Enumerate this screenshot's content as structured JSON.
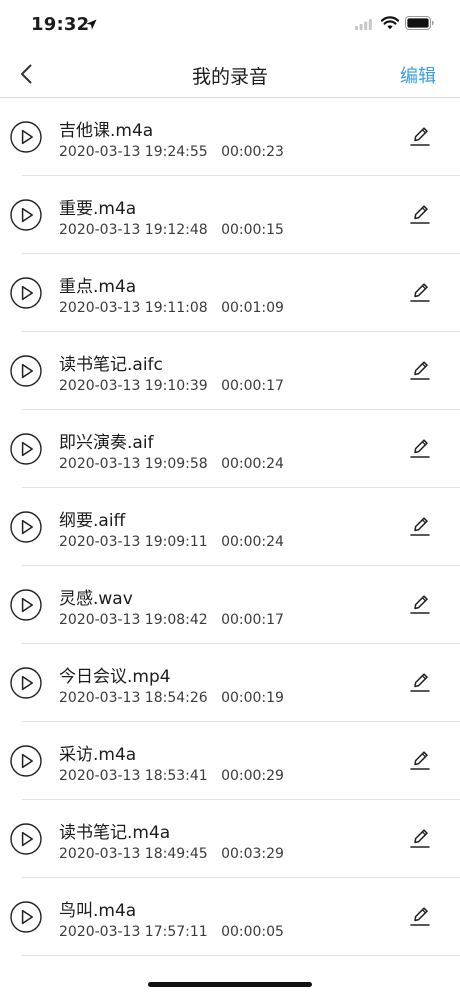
{
  "status_bar": {
    "time": "19:32"
  },
  "nav": {
    "title": "我的录音",
    "edit_label": "编辑"
  },
  "recordings": [
    {
      "name": "吉他课.m4a",
      "date": "2020-03-13 19:24:55",
      "duration": "00:00:23"
    },
    {
      "name": "重要.m4a",
      "date": "2020-03-13 19:12:48",
      "duration": "00:00:15"
    },
    {
      "name": "重点.m4a",
      "date": "2020-03-13 19:11:08",
      "duration": "00:01:09"
    },
    {
      "name": "读书笔记.aifc",
      "date": "2020-03-13 19:10:39",
      "duration": "00:00:17"
    },
    {
      "name": "即兴演奏.aif",
      "date": "2020-03-13 19:09:58",
      "duration": "00:00:24"
    },
    {
      "name": "纲要.aiff",
      "date": "2020-03-13 19:09:11",
      "duration": "00:00:24"
    },
    {
      "name": "灵感.wav",
      "date": "2020-03-13 19:08:42",
      "duration": "00:00:17"
    },
    {
      "name": "今日会议.mp4",
      "date": "2020-03-13 18:54:26",
      "duration": "00:00:19"
    },
    {
      "name": "采访.m4a",
      "date": "2020-03-13 18:53:41",
      "duration": "00:00:29"
    },
    {
      "name": "读书笔记.m4a",
      "date": "2020-03-13 18:49:45",
      "duration": "00:03:29"
    },
    {
      "name": "鸟叫.m4a",
      "date": "2020-03-13 17:57:11",
      "duration": "00:00:05"
    }
  ],
  "colors": {
    "accent": "#3a9ee8",
    "text": "#1c1c1e",
    "divider": "#e3e3e3"
  },
  "icons": {
    "row_play": "play-circle-icon",
    "row_rename": "pencil-icon",
    "nav_back": "chevron-left-icon"
  }
}
